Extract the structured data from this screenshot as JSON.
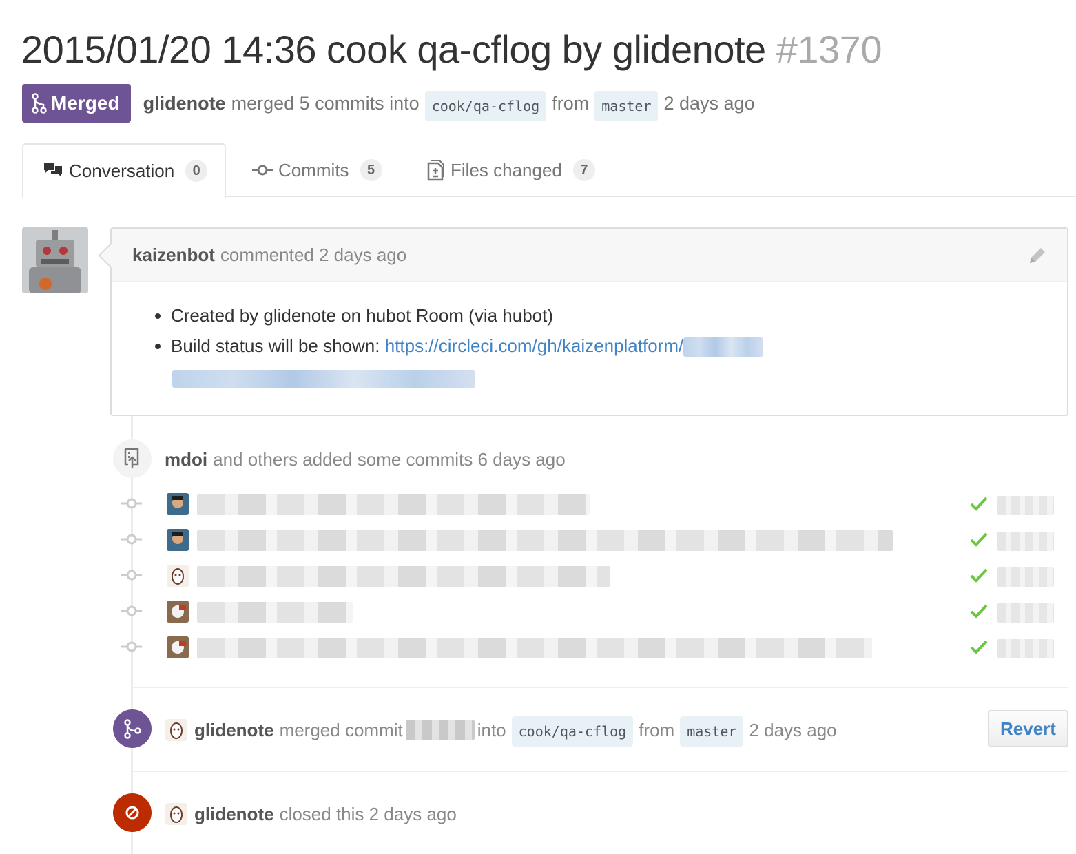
{
  "pr": {
    "title": "2015/01/20 14:36 cook qa-cflog by glidenote",
    "number": "#1370",
    "state": "Merged",
    "author": "glidenote",
    "merged_text": "merged 5 commits into",
    "base_branch": "cook/qa-cflog",
    "from_text": "from",
    "head_branch": "master",
    "time": "2 days ago"
  },
  "tabs": [
    {
      "label": "Conversation",
      "count": "0",
      "icon": "comment-discussion-icon"
    },
    {
      "label": "Commits",
      "count": "5",
      "icon": "git-commit-icon"
    },
    {
      "label": "Files changed",
      "count": "7",
      "icon": "file-diff-icon"
    }
  ],
  "comment": {
    "author": "kaizenbot",
    "action": "commented 2 days ago",
    "items": [
      "Created by glidenote on hubot Room (via hubot)",
      "Build status will be shown:"
    ],
    "link": "https://circleci.com/gh/kaizenplatform/"
  },
  "commits_event": {
    "author": "mdoi",
    "text": "and others added some commits 6 days ago",
    "status": "success"
  },
  "merge_event": {
    "author": "glidenote",
    "text_before": "merged commit",
    "text_into": "into",
    "base_branch": "cook/qa-cflog",
    "from_text": "from",
    "head_branch": "master",
    "time": "2 days ago",
    "revert_label": "Revert"
  },
  "close_event": {
    "author": "glidenote",
    "text": "closed this 2 days ago"
  },
  "colors": {
    "merged": "#6e5494",
    "closed": "#bd2c00",
    "link": "#4183c4",
    "success": "#6cc644"
  }
}
